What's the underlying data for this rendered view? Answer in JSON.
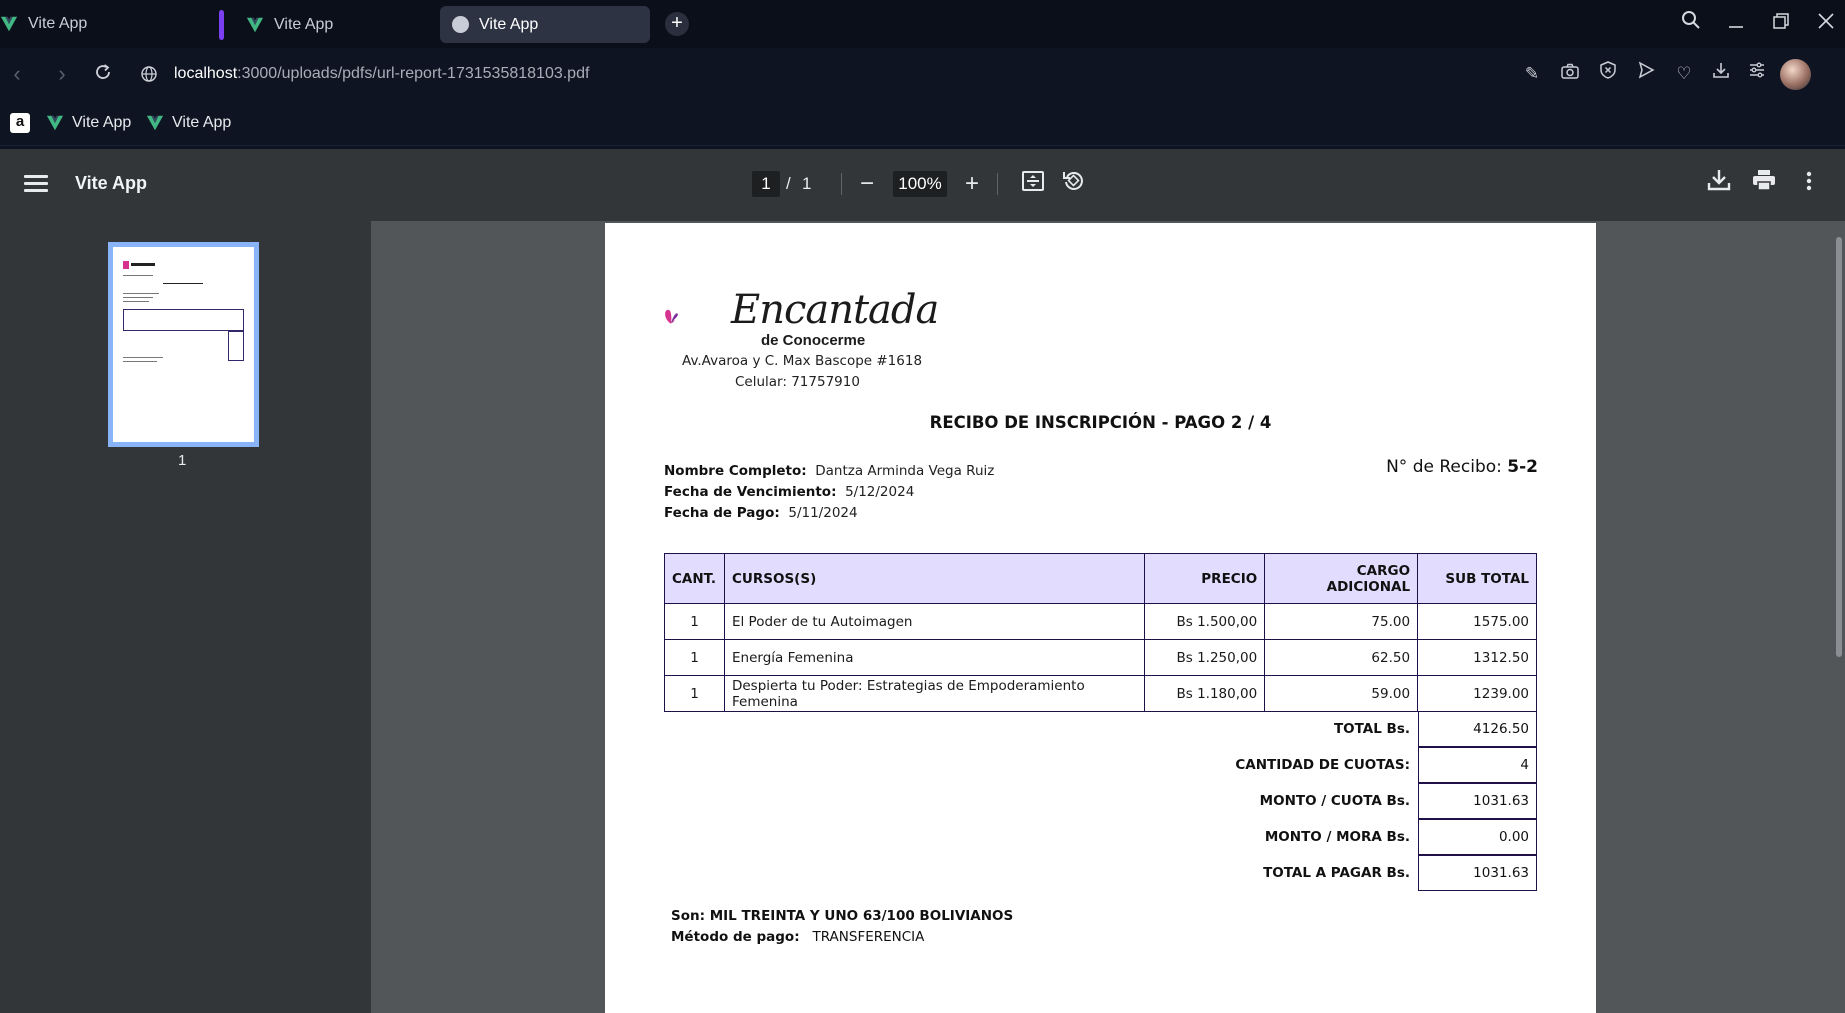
{
  "browser": {
    "tabs": [
      {
        "title": "Vite App"
      },
      {
        "title": "Vite App"
      },
      {
        "title": "Vite App"
      }
    ],
    "url_host": "localhost",
    "url_path": ":3000/uploads/pdfs/url-report-1731535818103.pdf",
    "bookmarks": [
      {
        "label": "Vite App"
      },
      {
        "label": "Vite App"
      }
    ]
  },
  "viewer": {
    "title": "Vite App",
    "current_page": "1",
    "page_separator": "/",
    "total_pages": "1",
    "zoom": "100%",
    "thumbnail_label": "1"
  },
  "document": {
    "brand_name": "Encantada",
    "brand_tagline": "de Conocerme",
    "address": "Av.Avaroa y C. Max Bascope #1618",
    "phone": "Celular: 71757910",
    "title": "RECIBO DE INSCRIPCIÓN - PAGO 2 / 4",
    "fields": {
      "name_label": "Nombre Completo:",
      "name_value": "Dantza Arminda Vega Ruiz",
      "due_label": "Fecha de Vencimiento:",
      "due_value": "5/12/2024",
      "paid_label": "Fecha de Pago:",
      "paid_value": "5/11/2024"
    },
    "receipt_label": "N° de Recibo:",
    "receipt_value": "5-2",
    "table": {
      "headers": [
        "CANT.",
        "CURSOS(S)",
        "PRECIO",
        "CARGO ADICIONAL",
        "SUB TOTAL"
      ],
      "rows": [
        [
          "1",
          "El Poder de tu Autoimagen",
          "Bs 1.500,00",
          "75.00",
          "1575.00"
        ],
        [
          "1",
          "Energía Femenina",
          "Bs 1.250,00",
          "62.50",
          "1312.50"
        ],
        [
          "1",
          "Despierta tu Poder: Estrategias de Empoderamiento Femenina",
          "Bs 1.180,00",
          "59.00",
          "1239.00"
        ]
      ]
    },
    "totals": [
      {
        "label": "TOTAL Bs.",
        "value": "4126.50"
      },
      {
        "label": "CANTIDAD DE CUOTAS:",
        "value": "4"
      },
      {
        "label": "MONTO / CUOTA Bs.",
        "value": "1031.63"
      },
      {
        "label": "MONTO / MORA Bs.",
        "value": "0.00"
      },
      {
        "label": "TOTAL A PAGAR Bs.",
        "value": "1031.63"
      }
    ],
    "amount_in_words": "Son: MIL TREINTA Y UNO 63/100 BOLIVIANOS",
    "payment_method_label": "Método de pago:",
    "payment_method_value": "TRANSFERENCIA"
  },
  "colors": {
    "tab_group_accent": "#7b3ff2",
    "table_header_bg": "#e2dcfe",
    "table_border": "#1f1147",
    "logo_magenta": "#d6338f",
    "logo_purple": "#7b2f9c"
  }
}
